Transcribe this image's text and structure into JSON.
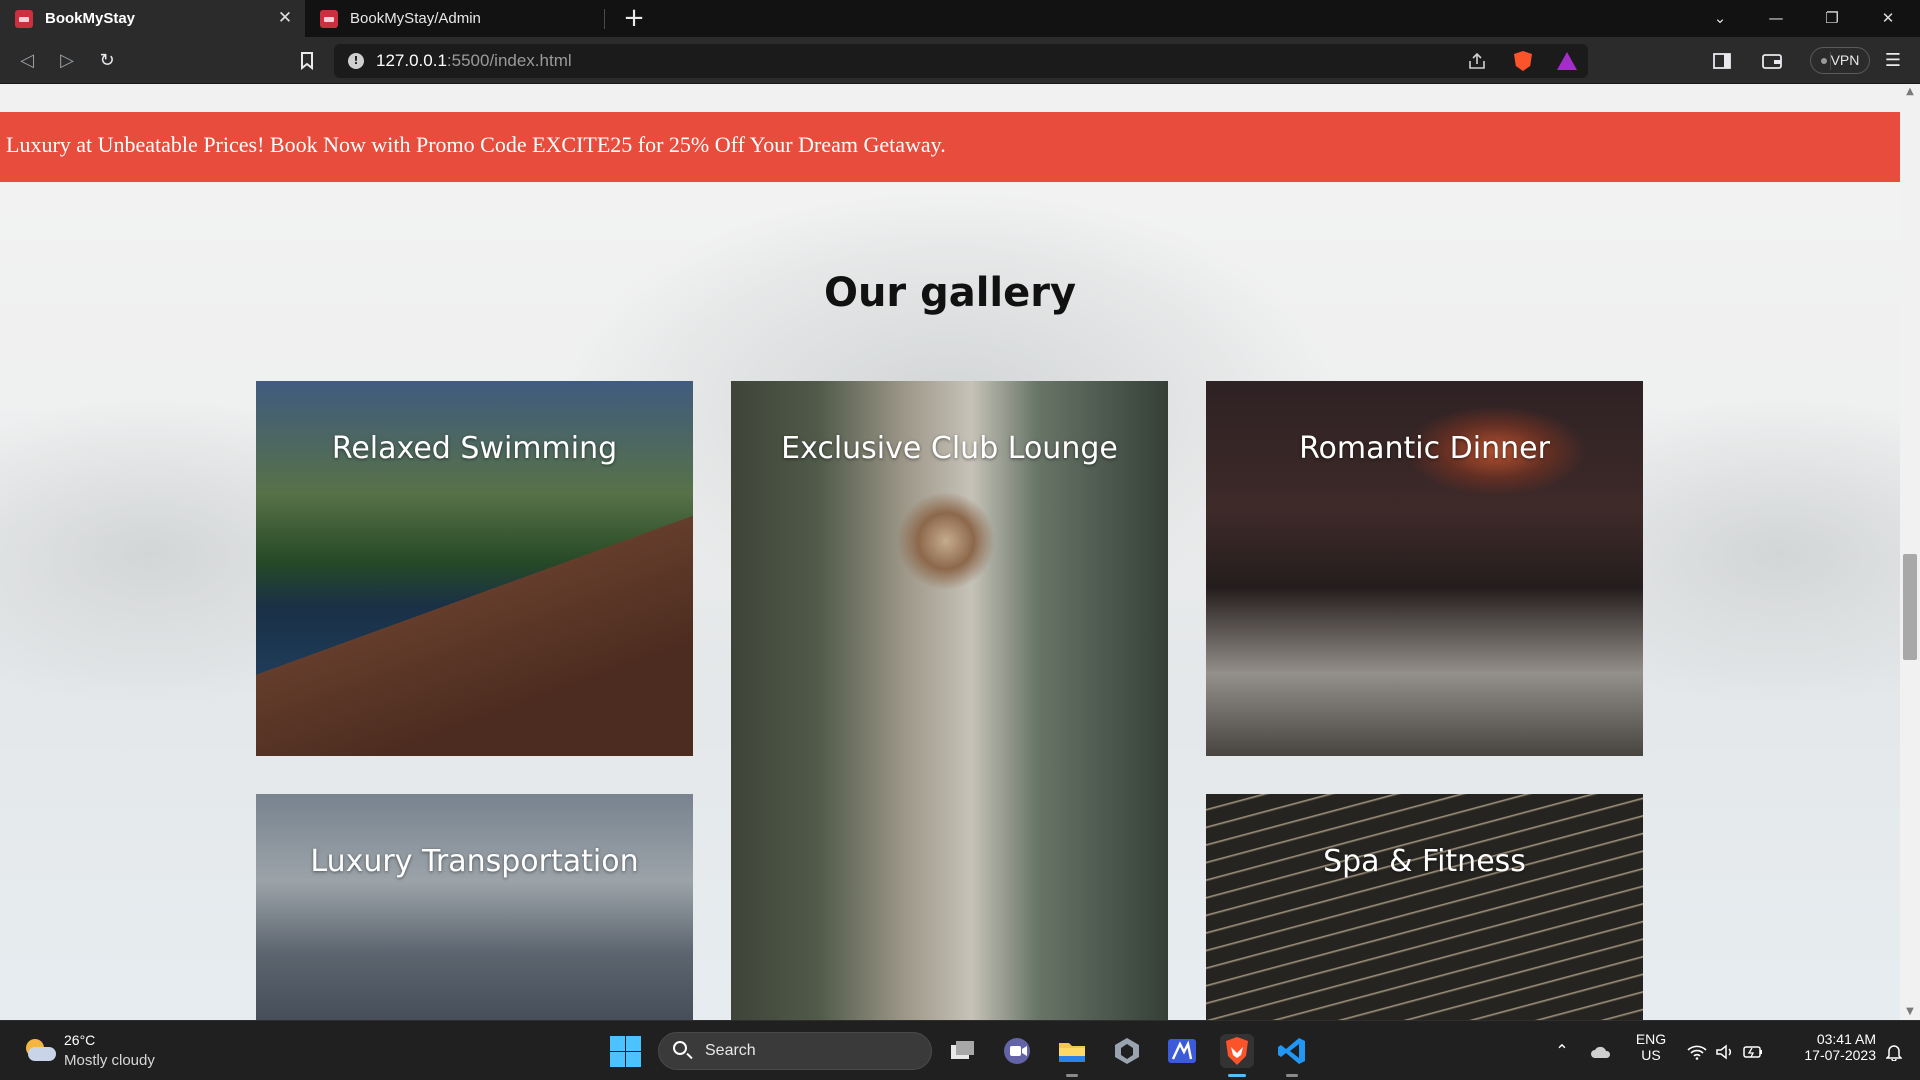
{
  "browser": {
    "tabs": [
      {
        "title": "BookMyStay",
        "active": true
      },
      {
        "title": "BookMyStay/Admin",
        "active": false
      }
    ],
    "new_tab_symbol": "+",
    "close_symbol": "✕",
    "address": {
      "host": "127.0.0.1",
      "path": ":5500/index.html"
    },
    "vpn_label": "VPN",
    "icons": [
      "back-icon",
      "forward-icon",
      "reload-icon",
      "bookmark-icon",
      "info-icon",
      "share-icon",
      "brave-shield-icon",
      "brave-rewards-icon",
      "sidebar-icon",
      "wallet-icon",
      "menu-icon"
    ],
    "window_controls": {
      "dropdown": "⌄",
      "minimize": "—",
      "restore": "❐",
      "close": "✕"
    }
  },
  "page": {
    "promo_text": "Luxury at Unbeatable Prices! Book Now with Promo Code EXCITE25 for 25% Off Your Dream Getaway.",
    "promo_color": "#e84c3d",
    "gallery_title": "Our gallery",
    "gallery_items": [
      {
        "label": "Relaxed Swimming"
      },
      {
        "label": "Exclusive Club Lounge"
      },
      {
        "label": "Romantic Dinner"
      },
      {
        "label": "Luxury Transportation"
      },
      {
        "label": "Spa & Fitness"
      }
    ]
  },
  "taskbar": {
    "weather": {
      "temp": "26°C",
      "desc": "Mostly cloudy"
    },
    "search_label": "Search",
    "language": {
      "lang": "ENG",
      "region": "US"
    },
    "clock": {
      "time": "03:41 AM",
      "date": "17-07-2023"
    },
    "accent_color": "#4cc2ff"
  }
}
